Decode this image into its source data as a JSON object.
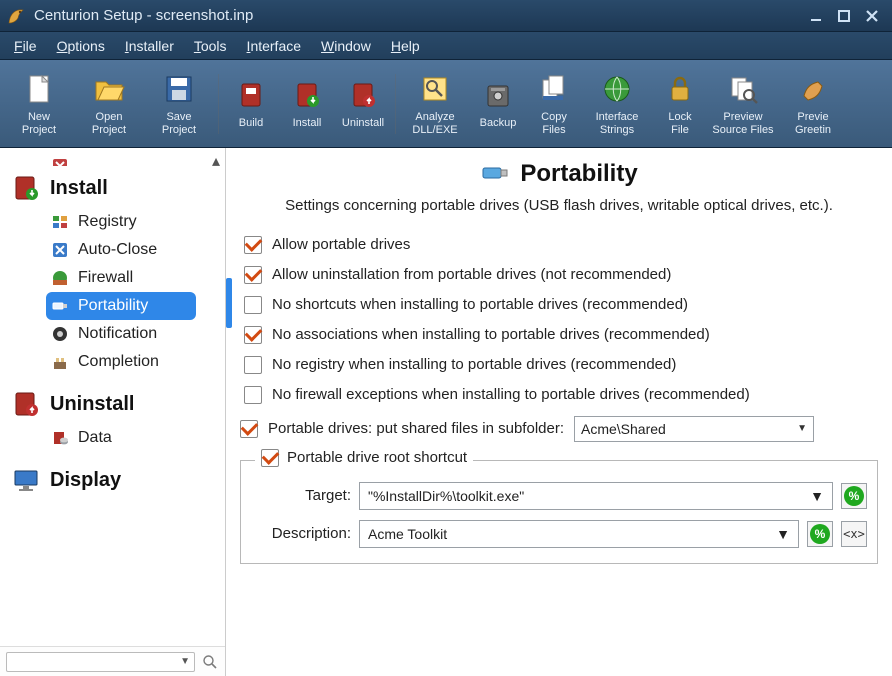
{
  "window": {
    "title": "Centurion Setup - screenshot.inp"
  },
  "menu": {
    "items": [
      {
        "label": "File",
        "ul": "F"
      },
      {
        "label": "Options",
        "ul": "O"
      },
      {
        "label": "Installer",
        "ul": "I"
      },
      {
        "label": "Tools",
        "ul": "T"
      },
      {
        "label": "Interface",
        "ul": "I"
      },
      {
        "label": "Window",
        "ul": "W"
      },
      {
        "label": "Help",
        "ul": "H"
      }
    ]
  },
  "toolbar": {
    "items": [
      {
        "id": "new-project",
        "label": "New\nProject"
      },
      {
        "id": "open-project",
        "label": "Open\nProject"
      },
      {
        "id": "save-project",
        "label": "Save\nProject"
      },
      {
        "sep": true
      },
      {
        "id": "build",
        "label": "Build"
      },
      {
        "id": "install",
        "label": "Install"
      },
      {
        "id": "uninstall",
        "label": "Uninstall"
      },
      {
        "sep": true
      },
      {
        "id": "analyze-dll-exe",
        "label": "Analyze\nDLL/EXE"
      },
      {
        "id": "backup",
        "label": "Backup"
      },
      {
        "id": "copy-files",
        "label": "Copy\nFiles"
      },
      {
        "id": "interface-strings",
        "label": "Interface\nStrings"
      },
      {
        "id": "lock-file",
        "label": "Lock\nFile"
      },
      {
        "id": "preview-source",
        "label": "Preview\nSource Files"
      },
      {
        "id": "preview-greeting",
        "label": "Previe\nGreetin"
      }
    ]
  },
  "sidebar": {
    "groups": [
      {
        "id": "install",
        "label": "Install",
        "items": [
          {
            "id": "registry",
            "label": "Registry"
          },
          {
            "id": "auto-close",
            "label": "Auto-Close"
          },
          {
            "id": "firewall",
            "label": "Firewall"
          },
          {
            "id": "portability",
            "label": "Portability",
            "selected": true
          },
          {
            "id": "notification",
            "label": "Notification"
          },
          {
            "id": "completion",
            "label": "Completion"
          }
        ]
      },
      {
        "id": "uninstall",
        "label": "Uninstall",
        "items": [
          {
            "id": "data",
            "label": "Data"
          }
        ]
      },
      {
        "id": "display",
        "label": "Display",
        "items": []
      }
    ]
  },
  "page": {
    "title": "Portability",
    "subtitle": "Settings concerning portable drives (USB flash drives, writable optical drives, etc.).",
    "options": [
      {
        "id": "allow-portable",
        "checked": true,
        "label": "Allow portable drives"
      },
      {
        "id": "allow-uninstall-portable",
        "checked": true,
        "label": "Allow uninstallation from portable drives (not recommended)"
      },
      {
        "id": "no-shortcuts",
        "checked": false,
        "label": "No shortcuts when installing to portable drives (recommended)"
      },
      {
        "id": "no-associations",
        "checked": true,
        "label": "No associations when installing to portable drives (recommended)"
      },
      {
        "id": "no-registry",
        "checked": false,
        "label": "No registry when installing to portable drives (recommended)"
      },
      {
        "id": "no-firewall",
        "checked": false,
        "label": "No firewall exceptions when installing to portable drives (recommended)"
      }
    ],
    "shared_subfolder": {
      "checked": true,
      "label": "Portable drives: put shared files in subfolder:",
      "value": "Acme\\Shared"
    },
    "root_shortcut": {
      "checked": true,
      "legend": "Portable drive root shortcut",
      "target_label": "Target:",
      "target_value": "\"%InstallDir%\\toolkit.exe\"",
      "description_label": "Description:",
      "description_value": "Acme Toolkit"
    }
  }
}
